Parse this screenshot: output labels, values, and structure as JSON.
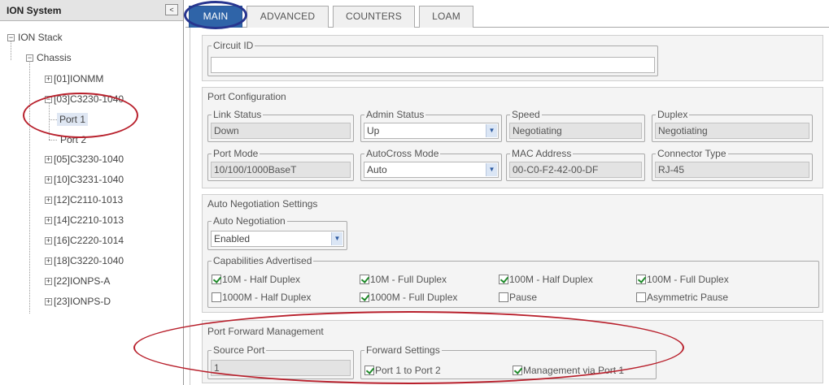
{
  "sidebar": {
    "title": "ION System",
    "collapse_label": "<",
    "root": "ION Stack",
    "chassis": "Chassis",
    "items": [
      {
        "label": "[01]IONMM",
        "toggle": "+"
      },
      {
        "label": "[03]C3230-1040",
        "toggle": "-"
      },
      {
        "label": "Port 1"
      },
      {
        "label": "Port 2"
      },
      {
        "label": "[05]C3230-1040",
        "toggle": "+"
      },
      {
        "label": "[10]C3231-1040",
        "toggle": "+"
      },
      {
        "label": "[12]C2110-1013",
        "toggle": "+"
      },
      {
        "label": "[14]C2210-1013",
        "toggle": "+"
      },
      {
        "label": "[16]C2220-1014",
        "toggle": "+"
      },
      {
        "label": "[18]C3220-1040",
        "toggle": "+"
      },
      {
        "label": "[22]IONPS-A",
        "toggle": "+"
      },
      {
        "label": "[23]IONPS-D",
        "toggle": "+"
      }
    ]
  },
  "tabs": [
    "MAIN",
    "ADVANCED",
    "COUNTERS",
    "LOAM"
  ],
  "circuit": {
    "label": "Circuit ID",
    "value": ""
  },
  "port_config": {
    "title": "Port Configuration",
    "link_status": {
      "label": "Link Status",
      "value": "Down"
    },
    "admin_status": {
      "label": "Admin Status",
      "value": "Up"
    },
    "speed": {
      "label": "Speed",
      "value": "Negotiating"
    },
    "duplex": {
      "label": "Duplex",
      "value": "Negotiating"
    },
    "port_mode": {
      "label": "Port Mode",
      "value": "10/100/1000BaseT"
    },
    "autocross": {
      "label": "AutoCross Mode",
      "value": "Auto"
    },
    "mac": {
      "label": "MAC Address",
      "value": "00-C0-F2-42-00-DF"
    },
    "connector": {
      "label": "Connector Type",
      "value": "RJ-45"
    }
  },
  "auto_neg": {
    "title": "Auto Negotiation Settings",
    "mode": {
      "label": "Auto Negotiation",
      "value": "Enabled"
    },
    "capabilities": {
      "label": "Capabilities Advertised",
      "items": [
        {
          "label": "10M - Half Duplex",
          "checked": true
        },
        {
          "label": "10M - Full Duplex",
          "checked": true
        },
        {
          "label": "100M - Half Duplex",
          "checked": true
        },
        {
          "label": "100M - Full Duplex",
          "checked": true
        },
        {
          "label": "1000M - Half Duplex",
          "checked": false
        },
        {
          "label": "1000M - Full Duplex",
          "checked": true
        },
        {
          "label": "Pause",
          "checked": false
        },
        {
          "label": "Asymmetric Pause",
          "checked": false
        }
      ]
    }
  },
  "port_forward": {
    "title": "Port Forward Management",
    "source_port": {
      "label": "Source Port",
      "value": "1"
    },
    "forward_settings": {
      "label": "Forward Settings",
      "items": [
        {
          "label": "Port 1 to Port 2",
          "checked": true
        },
        {
          "label": "Management via Port 1",
          "checked": true
        }
      ]
    }
  },
  "colors": {
    "tab_active": "#2f64a8",
    "annotation_red": "#b8202c",
    "annotation_blue": "#27358f",
    "check_green": "#1f8a2a"
  }
}
